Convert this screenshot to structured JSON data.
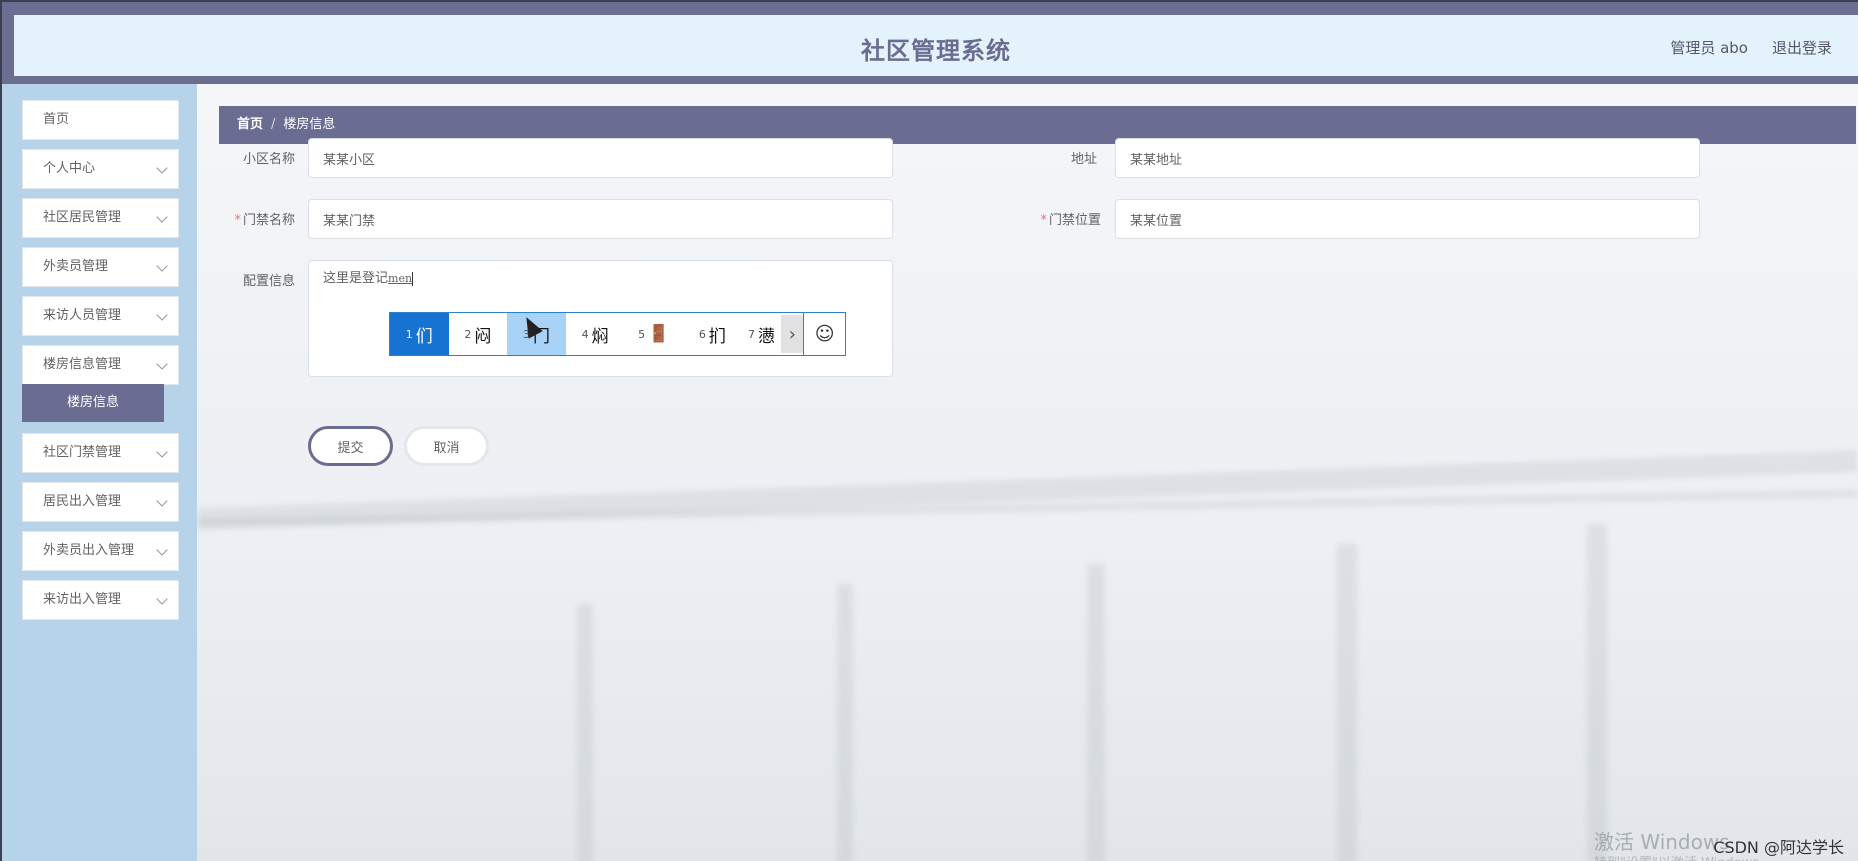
{
  "header": {
    "title": "社区管理系统",
    "user_label": "管理员 abo",
    "logout_label": "退出登录"
  },
  "sidebar": {
    "items": [
      {
        "label": "首页"
      },
      {
        "label": "个人中心"
      },
      {
        "label": "社区居民管理"
      },
      {
        "label": "外卖员管理"
      },
      {
        "label": "来访人员管理"
      },
      {
        "label": "楼房信息管理"
      },
      {
        "label": "社区门禁管理"
      },
      {
        "label": "居民出入管理"
      },
      {
        "label": "外卖员出入管理"
      },
      {
        "label": "来访出入管理"
      }
    ],
    "active_sub": "楼房信息"
  },
  "breadcrumb": {
    "home": "首页",
    "separator": "/",
    "current": "楼房信息"
  },
  "form": {
    "community_name": {
      "label": "小区名称",
      "value": "某某小区"
    },
    "address": {
      "label": "地址",
      "value": "某某地址"
    },
    "gate_name": {
      "label": "门禁名称",
      "value": "某某门禁"
    },
    "gate_location": {
      "label": "门禁位置",
      "value": "某某位置"
    },
    "config": {
      "label": "配置信息",
      "value": "这里是登记",
      "composing": "men"
    },
    "submit_label": "提交",
    "cancel_label": "取消"
  },
  "ime": {
    "candidates": [
      {
        "num": "1",
        "text": "们"
      },
      {
        "num": "2",
        "text": "闷"
      },
      {
        "num": "3",
        "text": "门"
      },
      {
        "num": "4",
        "text": "焖"
      },
      {
        "num": "5",
        "text": "🚪"
      },
      {
        "num": "6",
        "text": "扪"
      },
      {
        "num": "7",
        "text": "懑"
      }
    ],
    "next_glyph": "›",
    "emoji_glyph": "☺"
  },
  "overlay": {
    "windows_activate": "激活 Windows",
    "windows_sub": "转到\"设置\"以激活 Windows",
    "csdn": "CSDN @阿达学长"
  }
}
